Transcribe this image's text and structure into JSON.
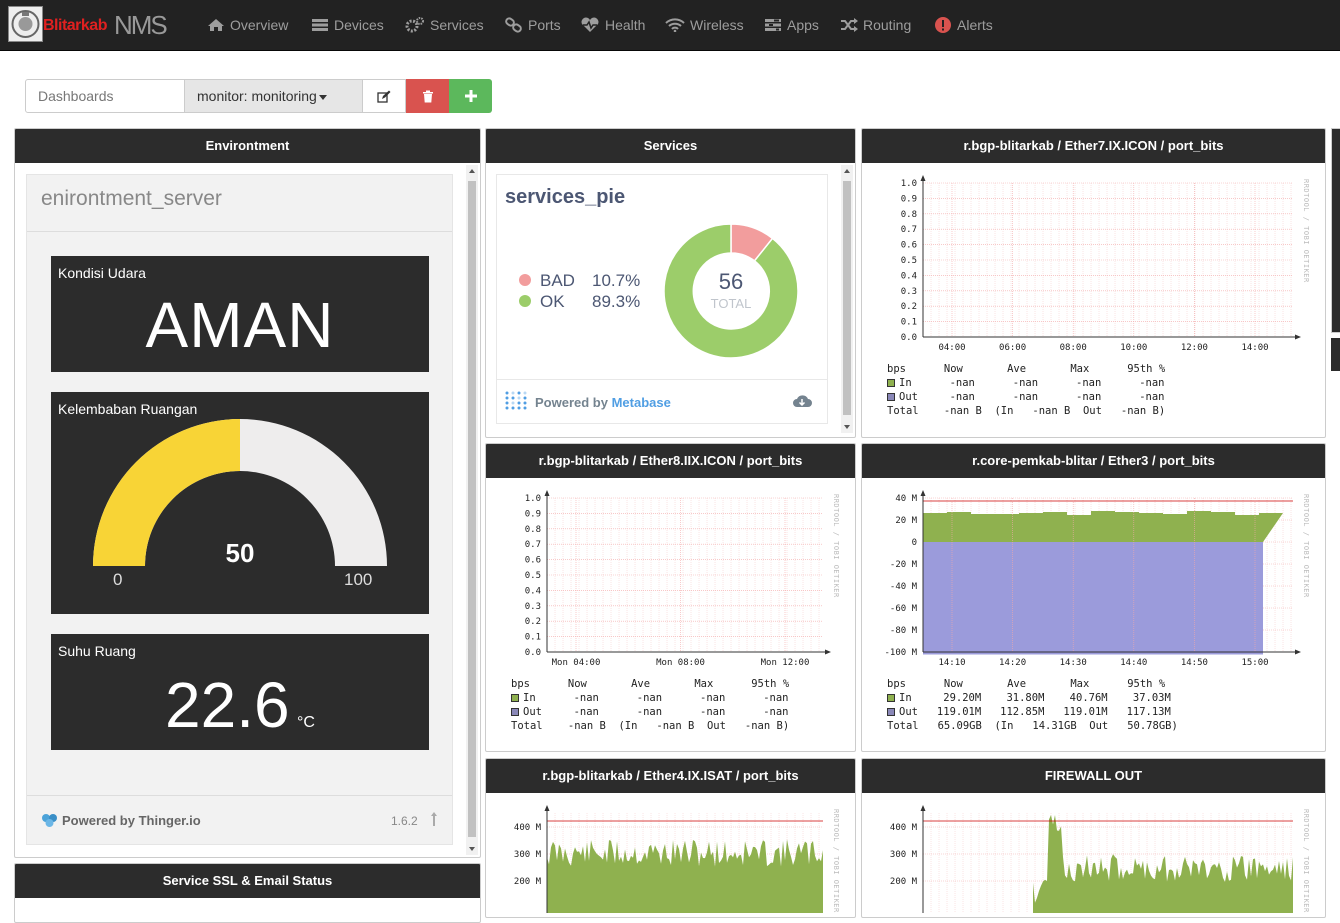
{
  "brand": {
    "name_red": "Blitarkab",
    "name_grey": "NMS"
  },
  "nav": [
    {
      "label": "Overview",
      "icon": "home-icon"
    },
    {
      "label": "Devices",
      "icon": "server-icon"
    },
    {
      "label": "Services",
      "icon": "cogs-icon"
    },
    {
      "label": "Ports",
      "icon": "link-icon"
    },
    {
      "label": "Health",
      "icon": "heartbeat-icon"
    },
    {
      "label": "Wireless",
      "icon": "wifi-icon"
    },
    {
      "label": "Apps",
      "icon": "tasks-icon"
    },
    {
      "label": "Routing",
      "icon": "random-icon"
    },
    {
      "label": "Alerts",
      "icon": "exclamation-circle-icon"
    }
  ],
  "dashboard": {
    "input_placeholder": "Dashboards",
    "selected": "monitor: monitoring"
  },
  "colors": {
    "navbar": "#222222",
    "widget_header": "#2c2c2c",
    "danger": "#d9534f",
    "success": "#5cb85c",
    "graph_in": "#8fb14f",
    "graph_out": "#9b9bdb",
    "pie_bad": "#f29d9d",
    "pie_ok": "#9ccd6a",
    "gauge_fill": "#f8d436"
  },
  "environment": {
    "title": "Environtment",
    "panel_title": "enirontment_server",
    "udara": {
      "label": "Kondisi Udara",
      "value": "AMAN"
    },
    "kelembaban": {
      "label": "Kelembaban Ruangan",
      "value": 50,
      "value_text": "50",
      "min": "0",
      "max": "100"
    },
    "suhu": {
      "label": "Suhu Ruang",
      "value": "22.6",
      "unit": "°C"
    },
    "powered_by": "Powered by Thinger.io",
    "version": "1.6.2"
  },
  "services": {
    "title": "Services",
    "panel_title": "services_pie",
    "bad_label": "BAD",
    "bad_pct": "10.7%",
    "ok_label": "OK",
    "ok_pct": "89.3%",
    "total": "56",
    "total_label": "TOTAL",
    "powered_prefix": "Powered by ",
    "powered_name": "Metabase"
  },
  "ssl_title": "Service SSL & Email Status",
  "rrd_watermark": "RRDTOOL / TOBI OETIKER",
  "graphs": [
    {
      "title": "r.bgp-blitarkab / Ether7.IX.ICON / port_bits",
      "y_ticks": [
        "1.0",
        "0.9",
        "0.8",
        "0.7",
        "0.6",
        "0.5",
        "0.4",
        "0.3",
        "0.2",
        "0.1",
        "0.0"
      ],
      "x_ticks": [
        "04:00",
        "06:00",
        "08:00",
        "10:00",
        "12:00",
        "14:00"
      ],
      "legend_header": "bps      Now       Ave       Max      95th %",
      "legend_in": "In      -nan      -nan      -nan      -nan",
      "legend_out": "Out     -nan      -nan      -nan      -nan",
      "legend_total": "Total    -nan B  (In   -nan B  Out   -nan B)"
    },
    {
      "title": "r.bgp-blitarkab / Ether8.IIX.ICON / port_bits",
      "y_ticks": [
        "1.0",
        "0.9",
        "0.8",
        "0.7",
        "0.6",
        "0.5",
        "0.4",
        "0.3",
        "0.2",
        "0.1",
        "0.0"
      ],
      "x_ticks": [
        "Mon 04:00",
        "Mon 08:00",
        "Mon 12:00"
      ],
      "legend_header": "bps      Now       Ave       Max      95th %",
      "legend_in": "In      -nan      -nan      -nan      -nan",
      "legend_out": "Out     -nan      -nan      -nan      -nan",
      "legend_total": "Total    -nan B  (In   -nan B  Out   -nan B)"
    },
    {
      "title": "r.core-pemkab-blitar / Ether3 / port_bits",
      "y_ticks": [
        "40 M",
        "20 M",
        "0",
        "-20 M",
        "-40 M",
        "-60 M",
        "-80 M",
        "-100 M"
      ],
      "x_ticks": [
        "14:10",
        "14:20",
        "14:30",
        "14:40",
        "14:50",
        "15:00"
      ],
      "legend_header": "bps      Now       Ave       Max      95th %",
      "legend_in": "In     29.20M    31.80M    40.76M    37.03M",
      "legend_out": "Out   119.01M   112.85M   119.01M   117.13M",
      "legend_total": "Total   65.09GB  (In   14.31GB  Out   50.78GB)"
    },
    {
      "title": "r.bgp-blitarkab / Ether4.IX.ISAT / port_bits",
      "y_ticks": [
        "400 M",
        "300 M",
        "200 M"
      ]
    },
    {
      "title": "FIREWALL OUT",
      "y_ticks": [
        "400 M",
        "300 M",
        "200 M"
      ]
    }
  ]
}
